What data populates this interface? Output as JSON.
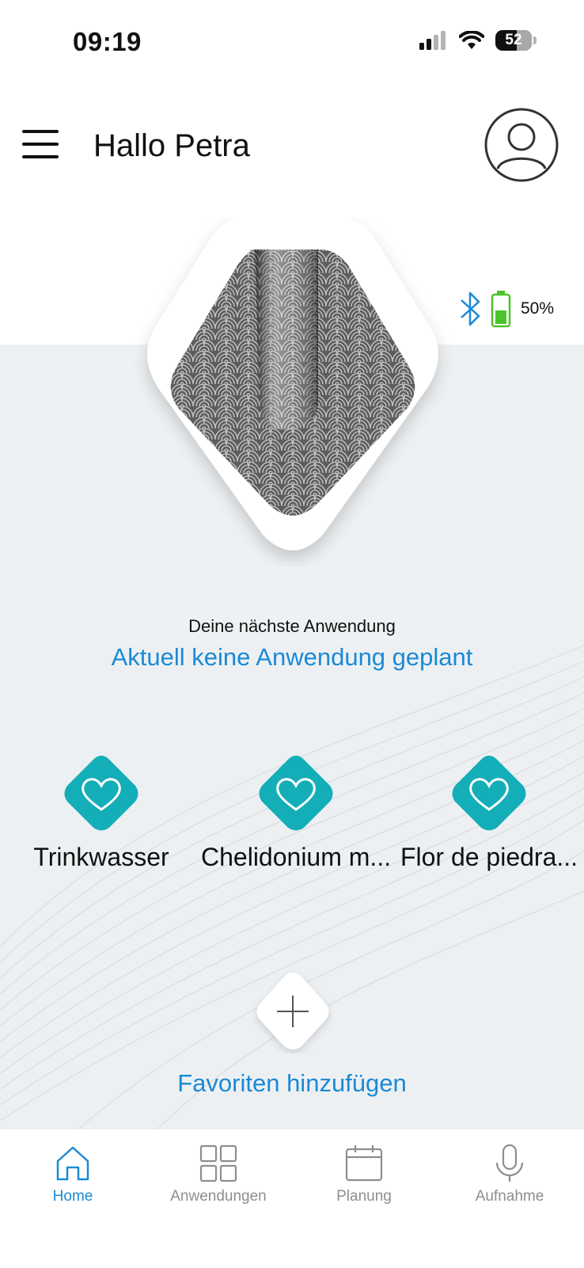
{
  "status_bar": {
    "time": "09:19",
    "battery_level": "52",
    "icons": [
      "signal-icon",
      "wifi-icon",
      "battery-icon"
    ]
  },
  "header": {
    "greeting": "Hallo Petra",
    "menu_icon": "hamburger-menu-icon",
    "avatar_icon": "user-avatar-icon"
  },
  "device": {
    "battery_percent": "50%",
    "bluetooth_icon": "bluetooth-icon",
    "battery_fill": 0.5,
    "colors": {
      "bluetooth": "#1a8ad6",
      "battery": "#4cc22b"
    }
  },
  "next_application": {
    "label": "Deine nächste Anwendung",
    "value": "Aktuell keine Anwendung geplant"
  },
  "favorites": [
    {
      "label": "Trinkwasser",
      "icon": "heart-icon"
    },
    {
      "label": "Chelidonium m...",
      "icon": "heart-icon"
    },
    {
      "label": "Flor de piedra...",
      "icon": "heart-icon"
    }
  ],
  "add_favorites": {
    "label": "Favoriten hinzufügen",
    "icon": "plus-icon"
  },
  "bottom_nav": [
    {
      "label": "Home",
      "icon": "home-icon",
      "active": true
    },
    {
      "label": "Anwendungen",
      "icon": "grid-icon",
      "active": false
    },
    {
      "label": "Planung",
      "icon": "calendar-icon",
      "active": false
    },
    {
      "label": "Aufnahme",
      "icon": "microphone-icon",
      "active": false
    }
  ],
  "colors": {
    "accent": "#1a8ad6",
    "favorite": "#14aeb8",
    "background": "#edf0f3"
  }
}
